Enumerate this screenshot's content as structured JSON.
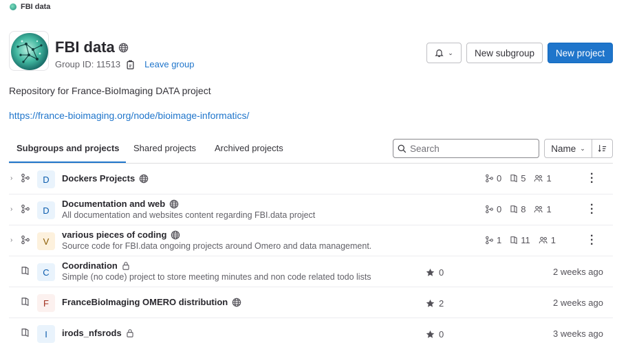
{
  "breadcrumb": {
    "label": "FBI data"
  },
  "group": {
    "name": "FBI data",
    "id_label": "Group ID: 11513",
    "leave_label": "Leave group",
    "description": "Repository for France-BioImaging DATA project",
    "url": "https://france-bioimaging.org/node/bioimage-informatics/"
  },
  "actions": {
    "new_subgroup": "New subgroup",
    "new_project": "New project"
  },
  "tabs": [
    {
      "label": "Subgroups and projects"
    },
    {
      "label": "Shared projects"
    },
    {
      "label": "Archived projects"
    }
  ],
  "search": {
    "placeholder": "Search"
  },
  "sort": {
    "label": "Name"
  },
  "colors": {
    "primary": "#1f75cb",
    "badge_blue": "#e9f3fc",
    "badge_orange": "#fdf1dd",
    "badge_red": "#fcf1ef"
  },
  "rows": [
    {
      "letter": "D",
      "name": "Dockers Projects",
      "description": "",
      "subgroups": "0",
      "projects": "5",
      "members": "1"
    },
    {
      "letter": "D",
      "name": "Documentation and web",
      "description": "All documentation and websites content regarding FBI.data project",
      "subgroups": "0",
      "projects": "8",
      "members": "1"
    },
    {
      "letter": "V",
      "name": "various pieces of coding",
      "description": "Source code for FBI.data ongoing projects around Omero and data management.",
      "subgroups": "1",
      "projects": "11",
      "members": "1"
    },
    {
      "letter": "C",
      "name": "Coordination",
      "description": "Simple (no code) project to store meeting minutes and non code related todo lists",
      "stars": "0",
      "updated": "2 weeks ago"
    },
    {
      "letter": "F",
      "name": "FranceBioImaging OMERO distribution",
      "description": "",
      "stars": "2",
      "updated": "2 weeks ago"
    },
    {
      "letter": "I",
      "name": "irods_nfsrods",
      "description": "",
      "stars": "0",
      "updated": "3 weeks ago"
    }
  ]
}
